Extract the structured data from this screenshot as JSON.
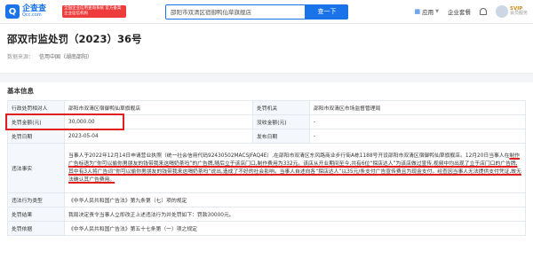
{
  "header": {
    "logo_name": "企查查",
    "logo_domain": "Qcc.com",
    "brand_badge": "全国企业信用查询系统 官方备案企业征信机构",
    "search_value": "邵阳市双清区宿御鸭仙草旗舰店",
    "search_button": "查一下",
    "nav": {
      "apps": "应用",
      "enterprise": "企业套餐",
      "vip_tag": "SVIP",
      "vip_sub": "会员服务"
    }
  },
  "title": {
    "heading": "邵双市监处罚（2023）36号",
    "source_label": "数据来源：",
    "source_value": "信用中国（湖南邵阳）"
  },
  "section": {
    "title": "基本信息",
    "rows": {
      "party_label": "行政处罚相对人",
      "party_value": "邵阳市双清区宿御鸭仙草旗舰店",
      "authority_label": "处罚机关",
      "authority_value": "邵阳市双清区市场监督管理局",
      "amount_label": "处罚金额(元)",
      "amount_value": "30,000.00",
      "confiscated_label": "没收金额(元)",
      "confiscated_value": "-",
      "date_label": "处罚日期",
      "date_value": "2023-05-04",
      "publish_label": "发布日期",
      "publish_value": "-",
      "facts_label": "违法事实",
      "facts_p1": "当事人于2022年12月14日申请营业执照（统一社会信用代码92430502MACSJFAQ4E）,在邵阳市双清区东风路商业步行街A栋1188号开设邵阳市双清区宿御鸭仙草旗舰店。12月20日当事人在",
      "facts_p1b": "制作广告标语为“你可以偷你男朋友的钱带我来这喝奶茶吗”的广告牌,随后立于该店门口,制作费用为332元。该店从开业期间至今,共有6位“探店达人”为该店做过宣传,视频中均出现了立于店门口的广告牌,其中有3人将广告词“你可以偷你男朋友的钱带我来这喝奶茶吗”说出,造成了不好的社会影响。当事人自述向各“探店达人”以35元/条支付广告宣传费且为现金支付。经查因当事人无法提供支付凭证,故无法确认其广告费用。",
      "type_label": "违法行为类型",
      "type_value": "《中华人民共和国广告法》第九条第（七）项的规定",
      "result_label": "处罚结果",
      "result_value": "我局决定责令当事人立即改正上述违法行为并处罚如下：罚款30000元。",
      "basis_label": "处罚依据",
      "basis_value": "《中华人民共和国广告法》第五十七条第（一）项之规定"
    }
  },
  "colors": {
    "accent": "#1a73e8",
    "highlight": "#e02020"
  }
}
